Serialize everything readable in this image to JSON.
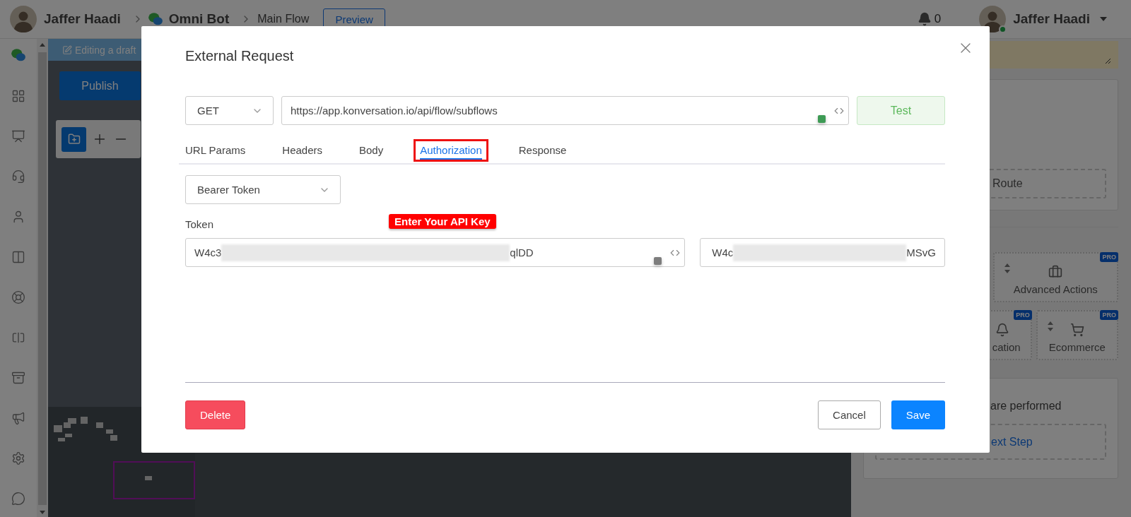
{
  "header": {
    "account_name": "Jaffer Haadi",
    "breadcrumbs": [
      {
        "label": "Omni Bot",
        "kind": "bot"
      },
      {
        "label": "Main Flow",
        "kind": "page"
      }
    ],
    "preview_button": "Preview",
    "notifications_count": "0",
    "user_name": "Jaffer Haadi"
  },
  "canvas": {
    "draft_notice": "Editing a draft",
    "publish_button": "Publish"
  },
  "right_panel": {
    "route_button": "Route",
    "action_tiles": [
      {
        "label": "Advanced Actions",
        "badge": "PRO"
      },
      {
        "label": "cation",
        "badge": "PRO"
      },
      {
        "label": "Ecommerce",
        "badge": "PRO"
      }
    ],
    "note_text": "are performed",
    "next_step_button": "ext Step"
  },
  "modal": {
    "title": "External Request",
    "method": "GET",
    "url": "https://app.konversation.io/api/flow/subflows",
    "test_button": "Test",
    "tabs": [
      {
        "label": "URL Params",
        "selected": false,
        "highlighted": false
      },
      {
        "label": "Headers",
        "selected": false,
        "highlighted": false
      },
      {
        "label": "Body",
        "selected": false,
        "highlighted": false
      },
      {
        "label": "Authorization",
        "selected": true,
        "highlighted": true
      },
      {
        "label": "Response",
        "selected": false,
        "highlighted": false
      }
    ],
    "auth_type": "Bearer Token",
    "token": {
      "label": "Token",
      "value_start": "W4c3",
      "value_end": "qlDD"
    },
    "token_preview": {
      "value_start": "W4c",
      "value_end": "MSvG"
    },
    "annotation": "Enter Your API Key",
    "delete_button": "Delete",
    "cancel_button": "Cancel",
    "save_button": "Save"
  }
}
